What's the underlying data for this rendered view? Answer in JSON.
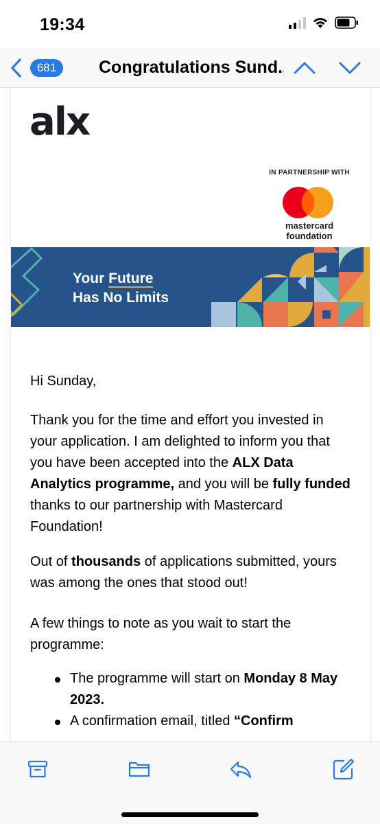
{
  "status_bar": {
    "time": "19:34"
  },
  "nav": {
    "unread_count": "681",
    "title": "Congratulations Sund...",
    "icons": [
      "back-chevron-icon",
      "chevron-up-icon",
      "chevron-down-icon"
    ]
  },
  "email": {
    "logo_text": "alx",
    "partner_label": "IN PARTNERSHIP WITH",
    "partner_name_line1": "mastercard",
    "partner_name_line2": "foundation",
    "banner_line1_prefix": "Your ",
    "banner_line1_highlight": "Future",
    "banner_line2": "Has No Limits",
    "greeting": "Hi Sunday,",
    "p1": {
      "t1": "Thank you for the time and effort you invested in your application. I am delighted to inform you that you have been accepted into the ",
      "b1": "ALX Data Analytics programme,",
      "t2": " and you will be ",
      "b2": "fully funded",
      "t3": " thanks to our partnership with Mastercard Foundation!"
    },
    "p2": {
      "t1": "Out of ",
      "b1": "thousands",
      "t2": " of applications submitted, yours was among the ones that stood out!"
    },
    "p3": "A few things to note as you wait to start the programme:",
    "bullets": [
      {
        "text": "The programme will start on ",
        "bold": "Monday 8 May 2023."
      },
      {
        "text": "A confirmation email, titled ",
        "bold": "“Confirm"
      }
    ]
  },
  "toolbar": {
    "icons": [
      "archive-icon",
      "folder-icon",
      "reply-icon",
      "compose-icon"
    ]
  },
  "colors": {
    "accent_blue": "#2a7ae4",
    "banner_blue": "#25538a",
    "mastercard_red": "#eb001b",
    "mastercard_orange": "#f79e1b"
  }
}
